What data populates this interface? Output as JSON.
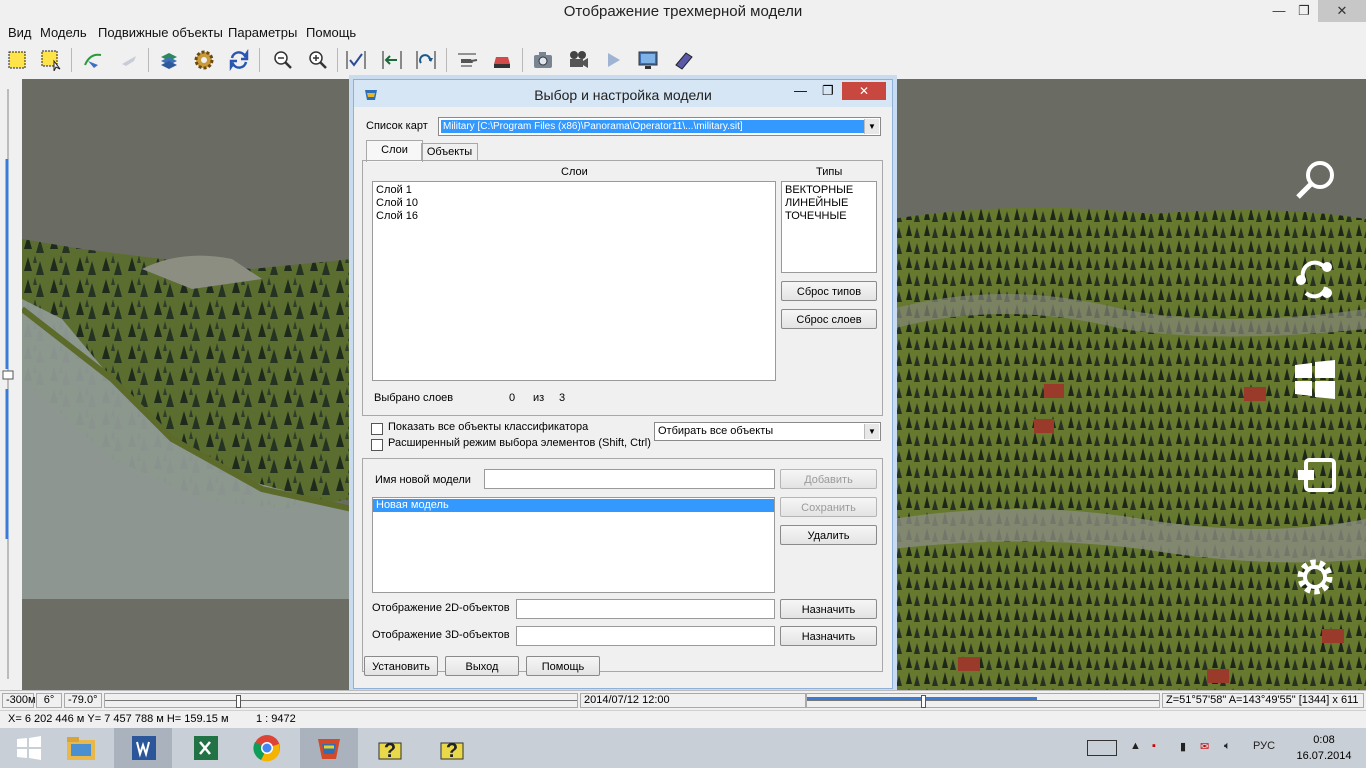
{
  "window": {
    "title": "Отображение трехмерной модели",
    "controls": [
      "—",
      "❐",
      "✕"
    ]
  },
  "menu": [
    "Вид",
    "Модель",
    "Подвижные объекты",
    "Параметры",
    "Помощь"
  ],
  "toolbar_icons": [
    "select-rect-icon",
    "select-frame-icon",
    "route-plane-icon",
    "plane-disabled-icon",
    "layers-icon",
    "settings-gear-icon",
    "refresh-icon",
    "zoom-out-icon",
    "zoom-in-icon",
    "check-view-icon",
    "move-left-icon",
    "return-view-icon",
    "helicopter-icon",
    "vehicle-icon",
    "camera-icon",
    "video-camera-icon",
    "play-icon",
    "monitor-icon",
    "book-icon"
  ],
  "dialog": {
    "title": "Выбор и настройка модели",
    "map_list_label": "Список карт",
    "map_list_value": "Military [C:\\Program Files (x86)\\Panorama\\Operator11\\...\\military.sit]",
    "tabs": [
      "Слои",
      "Объекты"
    ],
    "layers_header": "Слои",
    "types_header": "Типы",
    "layers": [
      "Слой 1",
      "Слой 10",
      "Слой 16"
    ],
    "types": [
      "ВЕКТОРНЫЕ",
      "ЛИНЕЙНЫЕ",
      "ТОЧЕЧНЫЕ"
    ],
    "reset_types": "Сброс типов",
    "reset_layers": "Сброс слоев",
    "selected_label": "Выбрано слоев",
    "selected_count": "0",
    "of_label": "из",
    "total_count": "3",
    "show_all_objects": "Показать все объекты классификатора",
    "extended_mode": "Расширенный режим выбора элементов (Shift, Ctrl)",
    "filter_combo": "Отбирать все объекты",
    "new_model_label": "Имя новой модели",
    "new_model_value": "",
    "add_button": "Добавить",
    "save_button": "Сохранить",
    "delete_button": "Удалить",
    "models": [
      "Новая модель"
    ],
    "display_2d_label": "Отображение 2D-объектов",
    "display_3d_label": "Отображение 3D-объектов",
    "display_2d_value": "",
    "display_3d_value": "",
    "assign_button": "Назначить",
    "install_button": "Установить",
    "exit_button": "Выход",
    "help_button": "Помощь"
  },
  "charms": [
    "search-icon",
    "share-icon",
    "start-icon",
    "devices-icon",
    "settings-icon"
  ],
  "statusbar": {
    "height": "-300м",
    "angle1": "6°",
    "angle2": "-79.0°",
    "datetime": "2014/07/12  12:00",
    "coords": "Z=51°57'58\"  A=143°49'55\"  [1344] x 611",
    "position": "X= 6 202 446 м  Y= 7 457 788 м  H= 159.15 м",
    "scale": "1 : 9472"
  },
  "taskbar": {
    "apps": [
      "start",
      "file-explorer",
      "word",
      "excel",
      "chrome",
      "panorama-3d",
      "help-1",
      "help-2"
    ],
    "lang": "РУС",
    "time": "0:08",
    "date": "16.07.2014"
  }
}
